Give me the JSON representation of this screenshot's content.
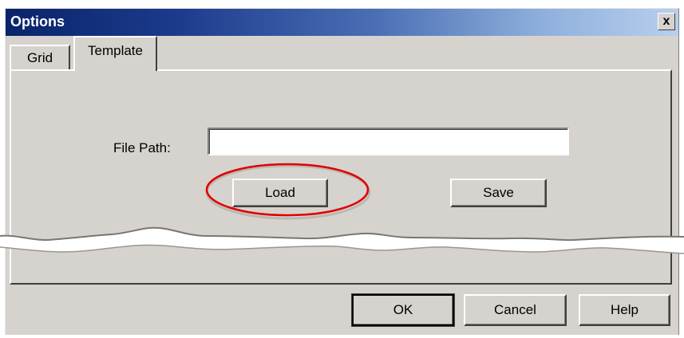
{
  "window": {
    "title": "Options",
    "close_label": "x"
  },
  "tabs": [
    {
      "label": "Grid"
    },
    {
      "label": "Template"
    }
  ],
  "template_tab": {
    "file_path_label": "File Path:",
    "file_path_value": "",
    "load_label": "Load",
    "save_label": "Save"
  },
  "footer": {
    "ok_label": "OK",
    "cancel_label": "Cancel",
    "help_label": "Help"
  },
  "colors": {
    "dialog_bg": "#d6d3ce",
    "titlebar_start": "#0a246a",
    "titlebar_end": "#b8cfee",
    "highlight_ellipse": "#e00000"
  }
}
